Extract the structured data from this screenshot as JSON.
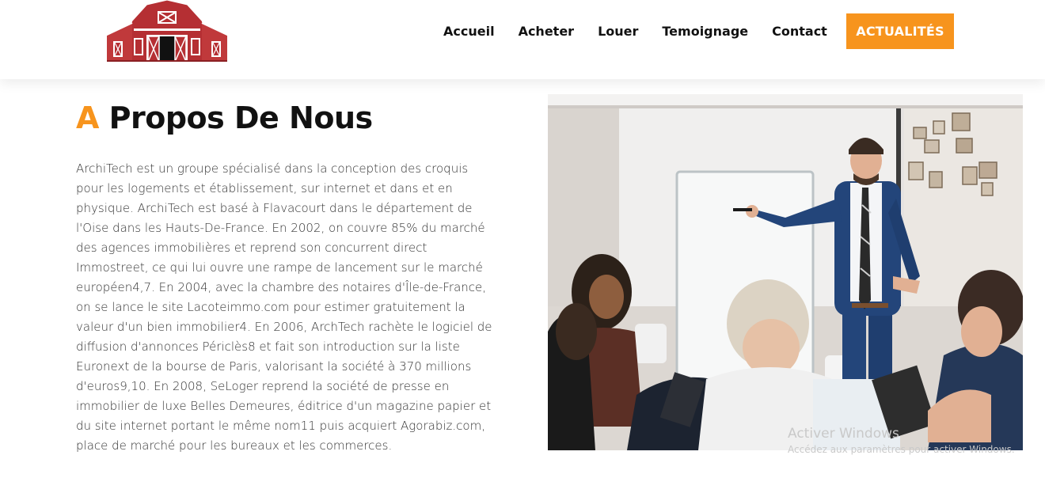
{
  "header": {
    "logo_icon": "barn-icon",
    "nav": [
      "Accueil",
      "Acheter",
      "Louer",
      "Temoignage",
      "Contact"
    ],
    "cta_label": "ACTUALITÉS"
  },
  "about": {
    "title_accent": "A",
    "title_rest": "Propos De Nous",
    "paragraph_lines": [
      "ArchiTech est un groupe spécialisé dans la conception des croquis",
      "pour les logements et établissement, sur internet et dans et en",
      "physique. ArchiTech est basé à Flavacourt dans le département de",
      "l'Oise dans les Hauts-De-France. En 2002, on couvre 85% du marché",
      "des agences immobilières et reprend son concurrent direct",
      "Immostreet, ce qui lui ouvre une rampe de lancement sur le marché",
      "européen4,7. En 2004, avec la chambre des notaires d'Île-de-France,",
      "on se lance le site Lacoteimmo.com pour estimer gratuitement la",
      "valeur d'un bien immobilier4. En 2006, ArchTech rachète le logiciel de",
      "diffusion d'annonces Périclès8 et fait son introduction sur la liste",
      "Euronext de la bourse de Paris, valorisant la société à 370 millions",
      "d'euros9,10. En 2008, SeLoger reprend la société de presse en",
      "immobilier de luxe Belles Demeures, éditrice d'un magazine papier et",
      "du site internet portant le même nom11 puis acquiert Agorabiz.com,",
      "place de marché pour les bureaux et les commerces."
    ]
  },
  "watermark": {
    "title": "Activer Windows",
    "subtitle": "Accédez aux paramètres pour activer Windows."
  },
  "colors": {
    "accent": "#f7941d",
    "barn_red": "#c0393b",
    "suit_blue": "#23457a"
  }
}
